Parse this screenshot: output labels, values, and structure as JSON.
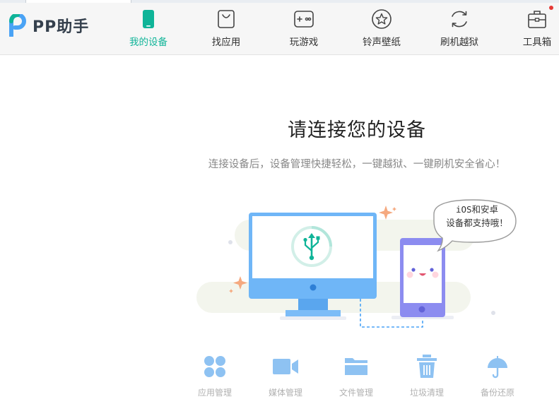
{
  "app": {
    "name": "PP助手"
  },
  "nav": [
    {
      "label": "我的设备",
      "icon": "phone-icon",
      "active": true
    },
    {
      "label": "找应用",
      "icon": "shopping-bag-icon",
      "active": false
    },
    {
      "label": "玩游戏",
      "icon": "gamepad-icon",
      "active": false
    },
    {
      "label": "铃声壁纸",
      "icon": "star-icon",
      "active": false
    },
    {
      "label": "刷机越狱",
      "icon": "refresh-icon",
      "active": false
    },
    {
      "label": "工具箱",
      "icon": "toolbox-icon",
      "active": false,
      "badge": true
    }
  ],
  "main": {
    "title": "请连接您的设备",
    "subtitle": "连接设备后，设备管理快捷轻松，一键越狱、一键刷机安全省心！",
    "bubble_line1": "iOS和安卓",
    "bubble_line2": "设备都支持哦！"
  },
  "tools": [
    {
      "label": "应用管理",
      "icon": "grid-icon"
    },
    {
      "label": "媒体管理",
      "icon": "video-camera-icon"
    },
    {
      "label": "文件管理",
      "icon": "folder-icon"
    },
    {
      "label": "垃圾清理",
      "icon": "trash-icon"
    },
    {
      "label": "备份还原",
      "icon": "umbrella-icon"
    }
  ],
  "colors": {
    "accent": "#0fb498",
    "brand_blue": "#4aa3f5",
    "monitor": "#6fb6f7",
    "phone": "#8c8cf0",
    "tool_icon": "#8ec2f2",
    "sparkle": "#f5a97f"
  }
}
